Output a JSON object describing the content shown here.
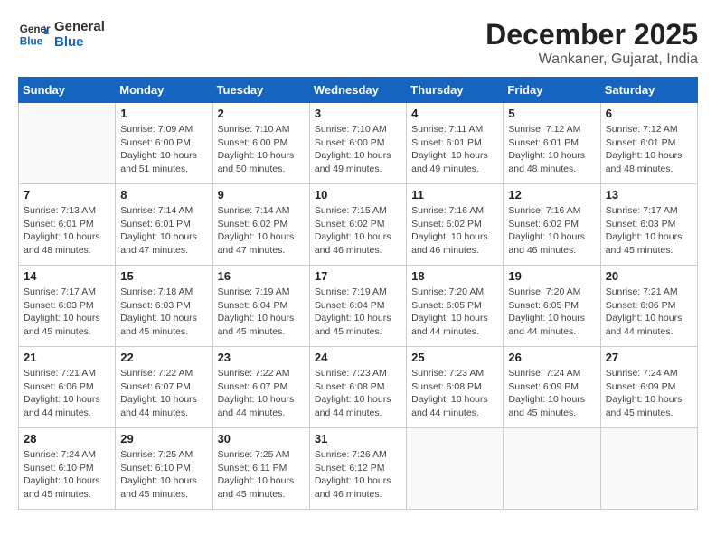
{
  "header": {
    "logo_line1": "General",
    "logo_line2": "Blue",
    "month_year": "December 2025",
    "location": "Wankaner, Gujarat, India"
  },
  "weekdays": [
    "Sunday",
    "Monday",
    "Tuesday",
    "Wednesday",
    "Thursday",
    "Friday",
    "Saturday"
  ],
  "weeks": [
    [
      {
        "day": "",
        "info": ""
      },
      {
        "day": "1",
        "info": "Sunrise: 7:09 AM\nSunset: 6:00 PM\nDaylight: 10 hours\nand 51 minutes."
      },
      {
        "day": "2",
        "info": "Sunrise: 7:10 AM\nSunset: 6:00 PM\nDaylight: 10 hours\nand 50 minutes."
      },
      {
        "day": "3",
        "info": "Sunrise: 7:10 AM\nSunset: 6:00 PM\nDaylight: 10 hours\nand 49 minutes."
      },
      {
        "day": "4",
        "info": "Sunrise: 7:11 AM\nSunset: 6:01 PM\nDaylight: 10 hours\nand 49 minutes."
      },
      {
        "day": "5",
        "info": "Sunrise: 7:12 AM\nSunset: 6:01 PM\nDaylight: 10 hours\nand 48 minutes."
      },
      {
        "day": "6",
        "info": "Sunrise: 7:12 AM\nSunset: 6:01 PM\nDaylight: 10 hours\nand 48 minutes."
      }
    ],
    [
      {
        "day": "7",
        "info": "Sunrise: 7:13 AM\nSunset: 6:01 PM\nDaylight: 10 hours\nand 48 minutes."
      },
      {
        "day": "8",
        "info": "Sunrise: 7:14 AM\nSunset: 6:01 PM\nDaylight: 10 hours\nand 47 minutes."
      },
      {
        "day": "9",
        "info": "Sunrise: 7:14 AM\nSunset: 6:02 PM\nDaylight: 10 hours\nand 47 minutes."
      },
      {
        "day": "10",
        "info": "Sunrise: 7:15 AM\nSunset: 6:02 PM\nDaylight: 10 hours\nand 46 minutes."
      },
      {
        "day": "11",
        "info": "Sunrise: 7:16 AM\nSunset: 6:02 PM\nDaylight: 10 hours\nand 46 minutes."
      },
      {
        "day": "12",
        "info": "Sunrise: 7:16 AM\nSunset: 6:02 PM\nDaylight: 10 hours\nand 46 minutes."
      },
      {
        "day": "13",
        "info": "Sunrise: 7:17 AM\nSunset: 6:03 PM\nDaylight: 10 hours\nand 45 minutes."
      }
    ],
    [
      {
        "day": "14",
        "info": "Sunrise: 7:17 AM\nSunset: 6:03 PM\nDaylight: 10 hours\nand 45 minutes."
      },
      {
        "day": "15",
        "info": "Sunrise: 7:18 AM\nSunset: 6:03 PM\nDaylight: 10 hours\nand 45 minutes."
      },
      {
        "day": "16",
        "info": "Sunrise: 7:19 AM\nSunset: 6:04 PM\nDaylight: 10 hours\nand 45 minutes."
      },
      {
        "day": "17",
        "info": "Sunrise: 7:19 AM\nSunset: 6:04 PM\nDaylight: 10 hours\nand 45 minutes."
      },
      {
        "day": "18",
        "info": "Sunrise: 7:20 AM\nSunset: 6:05 PM\nDaylight: 10 hours\nand 44 minutes."
      },
      {
        "day": "19",
        "info": "Sunrise: 7:20 AM\nSunset: 6:05 PM\nDaylight: 10 hours\nand 44 minutes."
      },
      {
        "day": "20",
        "info": "Sunrise: 7:21 AM\nSunset: 6:06 PM\nDaylight: 10 hours\nand 44 minutes."
      }
    ],
    [
      {
        "day": "21",
        "info": "Sunrise: 7:21 AM\nSunset: 6:06 PM\nDaylight: 10 hours\nand 44 minutes."
      },
      {
        "day": "22",
        "info": "Sunrise: 7:22 AM\nSunset: 6:07 PM\nDaylight: 10 hours\nand 44 minutes."
      },
      {
        "day": "23",
        "info": "Sunrise: 7:22 AM\nSunset: 6:07 PM\nDaylight: 10 hours\nand 44 minutes."
      },
      {
        "day": "24",
        "info": "Sunrise: 7:23 AM\nSunset: 6:08 PM\nDaylight: 10 hours\nand 44 minutes."
      },
      {
        "day": "25",
        "info": "Sunrise: 7:23 AM\nSunset: 6:08 PM\nDaylight: 10 hours\nand 44 minutes."
      },
      {
        "day": "26",
        "info": "Sunrise: 7:24 AM\nSunset: 6:09 PM\nDaylight: 10 hours\nand 45 minutes."
      },
      {
        "day": "27",
        "info": "Sunrise: 7:24 AM\nSunset: 6:09 PM\nDaylight: 10 hours\nand 45 minutes."
      }
    ],
    [
      {
        "day": "28",
        "info": "Sunrise: 7:24 AM\nSunset: 6:10 PM\nDaylight: 10 hours\nand 45 minutes."
      },
      {
        "day": "29",
        "info": "Sunrise: 7:25 AM\nSunset: 6:10 PM\nDaylight: 10 hours\nand 45 minutes."
      },
      {
        "day": "30",
        "info": "Sunrise: 7:25 AM\nSunset: 6:11 PM\nDaylight: 10 hours\nand 45 minutes."
      },
      {
        "day": "31",
        "info": "Sunrise: 7:26 AM\nSunset: 6:12 PM\nDaylight: 10 hours\nand 46 minutes."
      },
      {
        "day": "",
        "info": ""
      },
      {
        "day": "",
        "info": ""
      },
      {
        "day": "",
        "info": ""
      }
    ]
  ]
}
